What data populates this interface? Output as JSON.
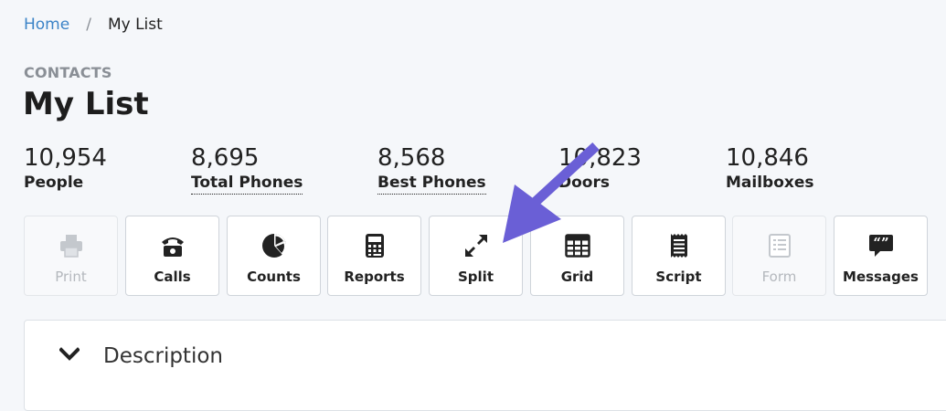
{
  "breadcrumb": {
    "home": "Home",
    "separator": "/",
    "current": "My List"
  },
  "header": {
    "section": "CONTACTS",
    "title": "My List"
  },
  "stats": [
    {
      "value": "10,954",
      "label": "People"
    },
    {
      "value": "8,695",
      "label": "Total Phones"
    },
    {
      "value": "8,568",
      "label": "Best Phones"
    },
    {
      "value": "10,823",
      "label": "Doors"
    },
    {
      "value": "10,846",
      "label": "Mailboxes"
    }
  ],
  "toolbar": [
    {
      "label": "Print",
      "icon": "print-icon",
      "disabled": true
    },
    {
      "label": "Calls",
      "icon": "phone-icon",
      "disabled": false
    },
    {
      "label": "Counts",
      "icon": "pie-chart-icon",
      "disabled": false
    },
    {
      "label": "Reports",
      "icon": "calculator-icon",
      "disabled": false
    },
    {
      "label": "Split",
      "icon": "expand-arrows-icon",
      "disabled": false
    },
    {
      "label": "Grid",
      "icon": "table-icon",
      "disabled": false
    },
    {
      "label": "Script",
      "icon": "receipt-icon",
      "disabled": false
    },
    {
      "label": "Form",
      "icon": "form-icon",
      "disabled": true
    },
    {
      "label": "Messages",
      "icon": "quote-bubble-icon",
      "disabled": false
    }
  ],
  "panel": {
    "title": "Description",
    "icon": "chevron-down-icon"
  },
  "annotation": {
    "color": "#6a5fd6"
  }
}
